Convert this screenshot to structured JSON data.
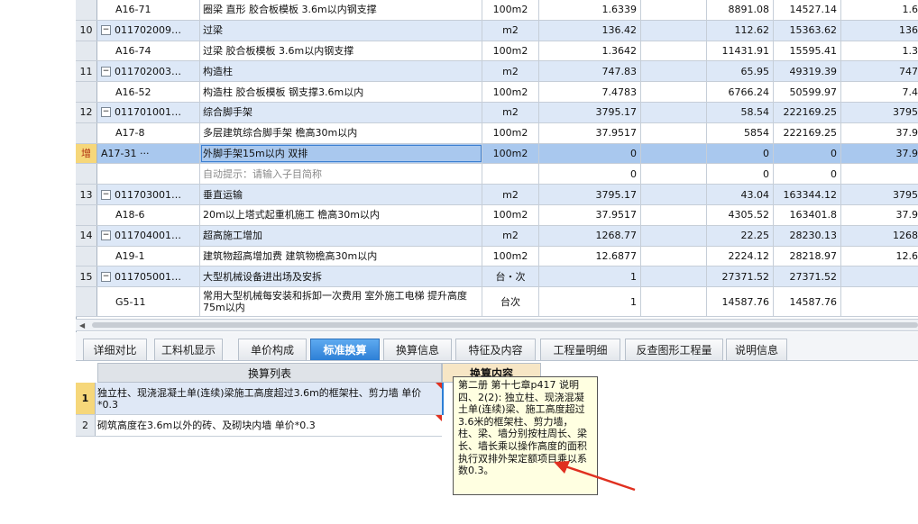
{
  "grid": {
    "rows": [
      {
        "num": "",
        "code": "A16-71",
        "name": "圈梁 直形 胶合板模板 3.6m以内钢支撑",
        "unit": "100m2",
        "qty": "1.6339",
        "price": "8891.08",
        "total": "14527.14",
        "extra": "1.6",
        "kind": "child"
      },
      {
        "num": "10",
        "code": "011702009…",
        "name": "过梁",
        "unit": "m2",
        "qty": "136.42",
        "price": "112.62",
        "total": "15363.62",
        "extra": "136",
        "kind": "parent"
      },
      {
        "num": "",
        "code": "A16-74",
        "name": "过梁 胶合板模板 3.6m以内钢支撑",
        "unit": "100m2",
        "qty": "1.3642",
        "price": "11431.91",
        "total": "15595.41",
        "extra": "1.3",
        "kind": "child"
      },
      {
        "num": "11",
        "code": "011702003…",
        "name": "构造柱",
        "unit": "m2",
        "qty": "747.83",
        "price": "65.95",
        "total": "49319.39",
        "extra": "747",
        "kind": "parent"
      },
      {
        "num": "",
        "code": "A16-52",
        "name": "构造柱 胶合板模板 钢支撑3.6m以内",
        "unit": "100m2",
        "qty": "7.4783",
        "price": "6766.24",
        "total": "50599.97",
        "extra": "7.4",
        "kind": "child"
      },
      {
        "num": "12",
        "code": "011701001…",
        "name": "综合脚手架",
        "unit": "m2",
        "qty": "3795.17",
        "price": "58.54",
        "total": "222169.25",
        "extra": "3795",
        "kind": "parent"
      },
      {
        "num": "",
        "code": "A17-8",
        "name": "多层建筑综合脚手架 檐高30m以内",
        "unit": "100m2",
        "qty": "37.9517",
        "price": "5854",
        "total": "222169.25",
        "extra": "37.9",
        "kind": "child"
      },
      {
        "num": "增",
        "code": "A17-31 ···",
        "name": "外脚手架15m以内 双排",
        "unit": "100m2",
        "qty": "0",
        "price": "0",
        "total": "0",
        "extra": "37.9",
        "kind": "selected"
      },
      {
        "num": "",
        "code": "",
        "name": "自动提示：请输入子目简称",
        "unit": "",
        "qty": "0",
        "price": "0",
        "total": "0",
        "extra": "",
        "kind": "hint"
      },
      {
        "num": "13",
        "code": "011703001…",
        "name": "垂直运输",
        "unit": "m2",
        "qty": "3795.17",
        "price": "43.04",
        "total": "163344.12",
        "extra": "3795",
        "kind": "parent"
      },
      {
        "num": "",
        "code": "A18-6",
        "name": "20m以上塔式起重机施工 檐高30m以内",
        "unit": "100m2",
        "qty": "37.9517",
        "price": "4305.52",
        "total": "163401.8",
        "extra": "37.9",
        "kind": "child"
      },
      {
        "num": "14",
        "code": "011704001…",
        "name": "超高施工增加",
        "unit": "m2",
        "qty": "1268.77",
        "price": "22.25",
        "total": "28230.13",
        "extra": "1268",
        "kind": "parent"
      },
      {
        "num": "",
        "code": "A19-1",
        "name": "建筑物超高增加费 建筑物檐高30m以内",
        "unit": "100m2",
        "qty": "12.6877",
        "price": "2224.12",
        "total": "28218.97",
        "extra": "12.6",
        "kind": "child"
      },
      {
        "num": "15",
        "code": "011705001…",
        "name": "大型机械设备进出场及安拆",
        "unit": "台・次",
        "qty": "1",
        "price": "27371.52",
        "total": "27371.52",
        "extra": "",
        "kind": "parent"
      },
      {
        "num": "",
        "code": "G5-11",
        "name": "常用大型机械每安装和拆卸一次费用 室外施工电梯 提升高度75m以内",
        "unit": "台次",
        "qty": "1",
        "price": "14587.76",
        "total": "14587.76",
        "extra": "",
        "kind": "child-tall"
      }
    ]
  },
  "tabs": [
    {
      "label": "详细对比"
    },
    {
      "label": "工料机显示"
    },
    {
      "label": "单价构成"
    },
    {
      "label": "标准换算",
      "active": true
    },
    {
      "label": "换算信息"
    },
    {
      "label": "特征及内容"
    },
    {
      "label": "工程量明细"
    },
    {
      "label": "反查图形工程量"
    },
    {
      "label": "说明信息"
    }
  ],
  "lower": {
    "header_list": "换算列表",
    "header_content": "换算内容",
    "rows": [
      {
        "num": "1",
        "text": "独立柱、现浇混凝土单(连续)梁施工高度超过3.6m的框架柱、剪力墙 单价*0.3"
      },
      {
        "num": "2",
        "text": "砌筑高度在3.6m以外的砖、及砌块内墙 单价*0.3"
      }
    ]
  },
  "tooltip": {
    "text": "第二册 第十七章p417 说明 四、2(2): 独立柱、现浇混凝土单(连续)梁、施工高度超过3.6米的框架柱、剪力墙，柱、梁、墙分别按柱周长、梁长、墙长乘以操作高度的面积执行双排外架定额项目乘以系数0.3。"
  },
  "colors": {
    "accent": "#2d7fd6",
    "parent_row": "#dde8f7",
    "selected_row": "#a9c8ee",
    "tooltip_bg": "#ffffe1",
    "arrow": "#e03020"
  }
}
